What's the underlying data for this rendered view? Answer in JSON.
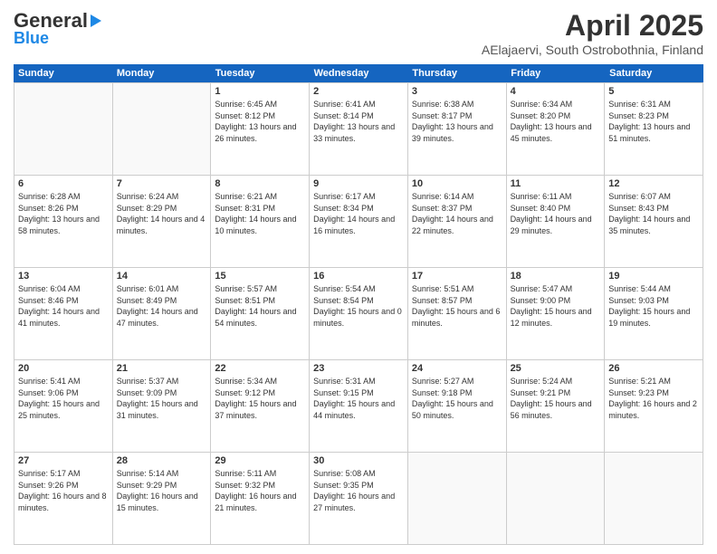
{
  "header": {
    "logo_line1": "General",
    "logo_line2": "Blue",
    "title": "April 2025",
    "subtitle": "AElajaervi, South Ostrobothnia, Finland"
  },
  "calendar": {
    "days_of_week": [
      "Sunday",
      "Monday",
      "Tuesday",
      "Wednesday",
      "Thursday",
      "Friday",
      "Saturday"
    ],
    "weeks": [
      [
        {
          "day": "",
          "info": ""
        },
        {
          "day": "",
          "info": ""
        },
        {
          "day": "1",
          "info": "Sunrise: 6:45 AM\nSunset: 8:12 PM\nDaylight: 13 hours and 26 minutes."
        },
        {
          "day": "2",
          "info": "Sunrise: 6:41 AM\nSunset: 8:14 PM\nDaylight: 13 hours and 33 minutes."
        },
        {
          "day": "3",
          "info": "Sunrise: 6:38 AM\nSunset: 8:17 PM\nDaylight: 13 hours and 39 minutes."
        },
        {
          "day": "4",
          "info": "Sunrise: 6:34 AM\nSunset: 8:20 PM\nDaylight: 13 hours and 45 minutes."
        },
        {
          "day": "5",
          "info": "Sunrise: 6:31 AM\nSunset: 8:23 PM\nDaylight: 13 hours and 51 minutes."
        }
      ],
      [
        {
          "day": "6",
          "info": "Sunrise: 6:28 AM\nSunset: 8:26 PM\nDaylight: 13 hours and 58 minutes."
        },
        {
          "day": "7",
          "info": "Sunrise: 6:24 AM\nSunset: 8:29 PM\nDaylight: 14 hours and 4 minutes."
        },
        {
          "day": "8",
          "info": "Sunrise: 6:21 AM\nSunset: 8:31 PM\nDaylight: 14 hours and 10 minutes."
        },
        {
          "day": "9",
          "info": "Sunrise: 6:17 AM\nSunset: 8:34 PM\nDaylight: 14 hours and 16 minutes."
        },
        {
          "day": "10",
          "info": "Sunrise: 6:14 AM\nSunset: 8:37 PM\nDaylight: 14 hours and 22 minutes."
        },
        {
          "day": "11",
          "info": "Sunrise: 6:11 AM\nSunset: 8:40 PM\nDaylight: 14 hours and 29 minutes."
        },
        {
          "day": "12",
          "info": "Sunrise: 6:07 AM\nSunset: 8:43 PM\nDaylight: 14 hours and 35 minutes."
        }
      ],
      [
        {
          "day": "13",
          "info": "Sunrise: 6:04 AM\nSunset: 8:46 PM\nDaylight: 14 hours and 41 minutes."
        },
        {
          "day": "14",
          "info": "Sunrise: 6:01 AM\nSunset: 8:49 PM\nDaylight: 14 hours and 47 minutes."
        },
        {
          "day": "15",
          "info": "Sunrise: 5:57 AM\nSunset: 8:51 PM\nDaylight: 14 hours and 54 minutes."
        },
        {
          "day": "16",
          "info": "Sunrise: 5:54 AM\nSunset: 8:54 PM\nDaylight: 15 hours and 0 minutes."
        },
        {
          "day": "17",
          "info": "Sunrise: 5:51 AM\nSunset: 8:57 PM\nDaylight: 15 hours and 6 minutes."
        },
        {
          "day": "18",
          "info": "Sunrise: 5:47 AM\nSunset: 9:00 PM\nDaylight: 15 hours and 12 minutes."
        },
        {
          "day": "19",
          "info": "Sunrise: 5:44 AM\nSunset: 9:03 PM\nDaylight: 15 hours and 19 minutes."
        }
      ],
      [
        {
          "day": "20",
          "info": "Sunrise: 5:41 AM\nSunset: 9:06 PM\nDaylight: 15 hours and 25 minutes."
        },
        {
          "day": "21",
          "info": "Sunrise: 5:37 AM\nSunset: 9:09 PM\nDaylight: 15 hours and 31 minutes."
        },
        {
          "day": "22",
          "info": "Sunrise: 5:34 AM\nSunset: 9:12 PM\nDaylight: 15 hours and 37 minutes."
        },
        {
          "day": "23",
          "info": "Sunrise: 5:31 AM\nSunset: 9:15 PM\nDaylight: 15 hours and 44 minutes."
        },
        {
          "day": "24",
          "info": "Sunrise: 5:27 AM\nSunset: 9:18 PM\nDaylight: 15 hours and 50 minutes."
        },
        {
          "day": "25",
          "info": "Sunrise: 5:24 AM\nSunset: 9:21 PM\nDaylight: 15 hours and 56 minutes."
        },
        {
          "day": "26",
          "info": "Sunrise: 5:21 AM\nSunset: 9:23 PM\nDaylight: 16 hours and 2 minutes."
        }
      ],
      [
        {
          "day": "27",
          "info": "Sunrise: 5:17 AM\nSunset: 9:26 PM\nDaylight: 16 hours and 8 minutes."
        },
        {
          "day": "28",
          "info": "Sunrise: 5:14 AM\nSunset: 9:29 PM\nDaylight: 16 hours and 15 minutes."
        },
        {
          "day": "29",
          "info": "Sunrise: 5:11 AM\nSunset: 9:32 PM\nDaylight: 16 hours and 21 minutes."
        },
        {
          "day": "30",
          "info": "Sunrise: 5:08 AM\nSunset: 9:35 PM\nDaylight: 16 hours and 27 minutes."
        },
        {
          "day": "",
          "info": ""
        },
        {
          "day": "",
          "info": ""
        },
        {
          "day": "",
          "info": ""
        }
      ]
    ]
  }
}
